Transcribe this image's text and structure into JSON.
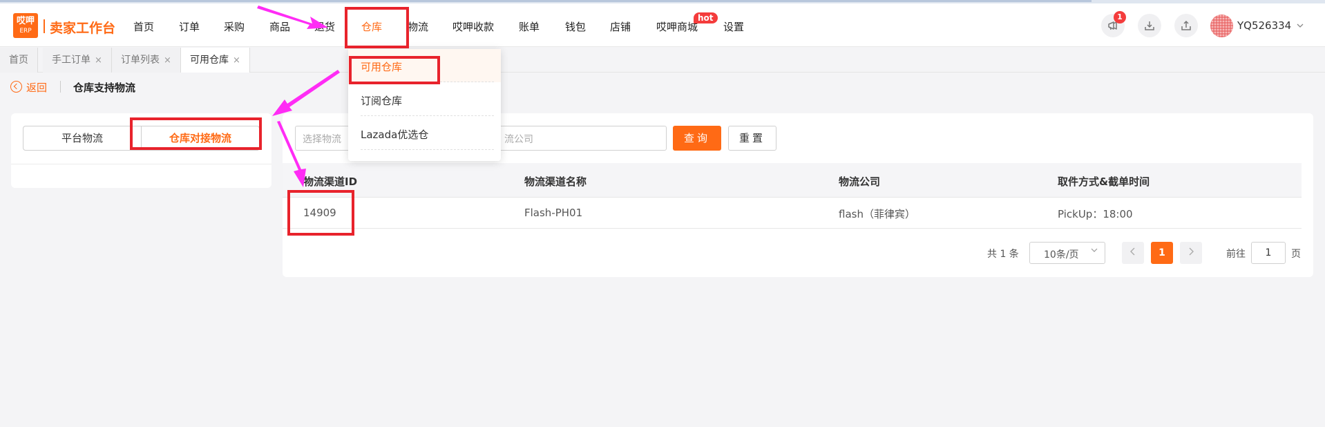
{
  "brand": {
    "logo_top": "哎呷",
    "logo_bottom": "ERP",
    "name": "卖家工作台"
  },
  "nav": [
    {
      "label": "首页"
    },
    {
      "label": "订单"
    },
    {
      "label": "采购"
    },
    {
      "label": "商品"
    },
    {
      "label": "退货"
    },
    {
      "label": "仓库",
      "active": true
    },
    {
      "label": "物流"
    },
    {
      "label": "哎呷收款"
    },
    {
      "label": "账单"
    },
    {
      "label": "钱包"
    },
    {
      "label": "店铺"
    },
    {
      "label": "哎呷商城"
    },
    {
      "label": "设置"
    }
  ],
  "hot_badge": "hot",
  "header_right": {
    "notification_count": "1",
    "icons": [
      "megaphone-icon",
      "download-icon",
      "upload-icon"
    ],
    "username": "YQ526334"
  },
  "tabs": [
    {
      "label": "首页",
      "closable": false
    },
    {
      "label": "手工订单",
      "closable": true
    },
    {
      "label": "订单列表",
      "closable": true
    },
    {
      "label": "可用仓库",
      "closable": true,
      "active": true
    }
  ],
  "tab_close_glyph": "×",
  "subheader": {
    "back": "返回",
    "title": "仓库支持物流"
  },
  "segments": {
    "left": "平台物流",
    "right": "仓库对接物流",
    "active": "right"
  },
  "filters": {
    "channel_placeholder": "选择物流",
    "company_placeholder": "流公司",
    "search_label": "查询",
    "reset_label": "重置"
  },
  "table": {
    "columns": [
      "物流渠道ID",
      "物流渠道名称",
      "物流公司",
      "取件方式&截单时间"
    ],
    "rows": [
      [
        "14909",
        "Flash-PH01",
        "flash（菲律宾）",
        "PickUp：18:00"
      ]
    ]
  },
  "pagination": {
    "total": "共 1 条",
    "page_size": "10条/页",
    "current_page": "1",
    "goto_label": "前往",
    "goto_value": "1",
    "goto_unit": "页"
  },
  "dropdown": {
    "items": [
      {
        "label": "可用仓库",
        "selected": true
      },
      {
        "label": "订阅仓库"
      },
      {
        "label": "Lazada优选仓"
      }
    ]
  },
  "colors": {
    "accent": "#ff6a15",
    "annotation": "#e8232c",
    "arrow": "#ff2cf5"
  }
}
